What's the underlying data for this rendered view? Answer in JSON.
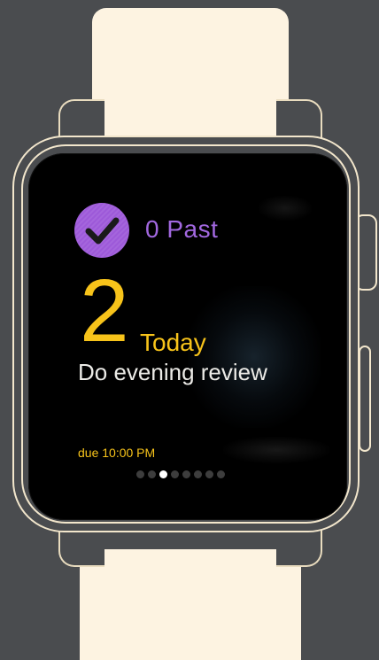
{
  "complication": {
    "past_label": "0 Past",
    "today_count": "2",
    "today_label": "Today",
    "task_title": "Do evening review",
    "due_text": "due 10:00 PM"
  },
  "page_indicator": {
    "total_pages": 8,
    "active_index": 2
  },
  "colors": {
    "accent_purple": "#9d59d9",
    "accent_yellow": "#f7c31a",
    "screen_bg": "#000000",
    "band": "#fdf3e1",
    "outline": "#f2e6cc"
  },
  "icons": {
    "status": "checkmark-circle-icon"
  }
}
